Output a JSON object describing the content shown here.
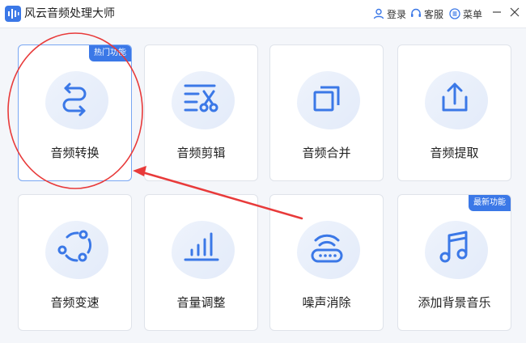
{
  "app": {
    "title": "风云音频处理大师"
  },
  "toolbar": {
    "login": "登录",
    "service": "客服",
    "menu": "菜单"
  },
  "colors": {
    "accent": "#3b78e7",
    "annotation": "#e83a3a"
  },
  "cards": [
    {
      "label": "音频转换",
      "icon": "convert-arrows-icon",
      "badge": "热门功能",
      "selected": true
    },
    {
      "label": "音频剪辑",
      "icon": "scissors-icon",
      "badge": ""
    },
    {
      "label": "音频合并",
      "icon": "merge-squares-icon",
      "badge": ""
    },
    {
      "label": "音频提取",
      "icon": "extract-upload-icon",
      "badge": ""
    },
    {
      "label": "音频变速",
      "icon": "speed-nodes-icon",
      "badge": ""
    },
    {
      "label": "音量调整",
      "icon": "volume-bars-icon",
      "badge": ""
    },
    {
      "label": "噪声消除",
      "icon": "noise-router-icon",
      "badge": ""
    },
    {
      "label": "添加背景音乐",
      "icon": "music-note-icon",
      "badge": "最新功能"
    }
  ]
}
